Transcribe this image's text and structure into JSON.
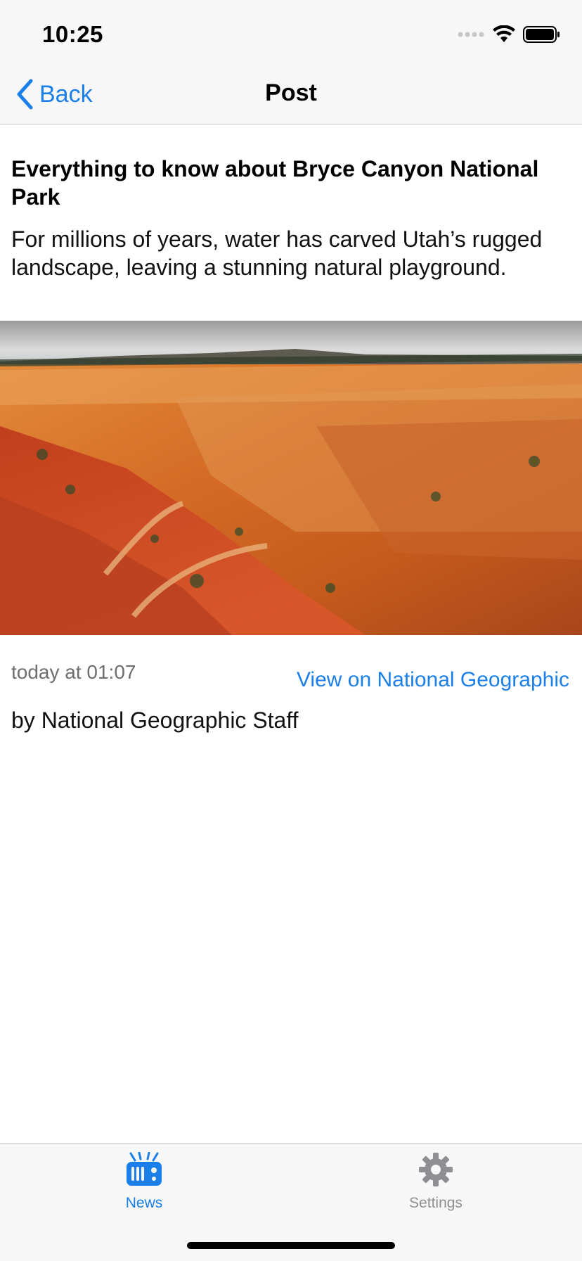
{
  "status_bar": {
    "time": "10:25"
  },
  "nav": {
    "back_label": "Back",
    "title": "Post"
  },
  "article": {
    "headline": "Everything to know about Bryce Canyon National Park",
    "summary": "For millions of years, water has carved Utah’s rugged landscape, leaving a stunning natural playground.",
    "timestamp": "today at 01:07",
    "source_link": "View on National Geographic",
    "byline": "by National Geographic Staff"
  },
  "tabs": [
    {
      "label": "News",
      "icon": "radio-icon",
      "active": true
    },
    {
      "label": "Settings",
      "icon": "gear-icon",
      "active": false
    }
  ],
  "colors": {
    "accent": "#1a7fe8",
    "inactive": "#8e8e93",
    "bar_bg": "#f7f7f7"
  }
}
